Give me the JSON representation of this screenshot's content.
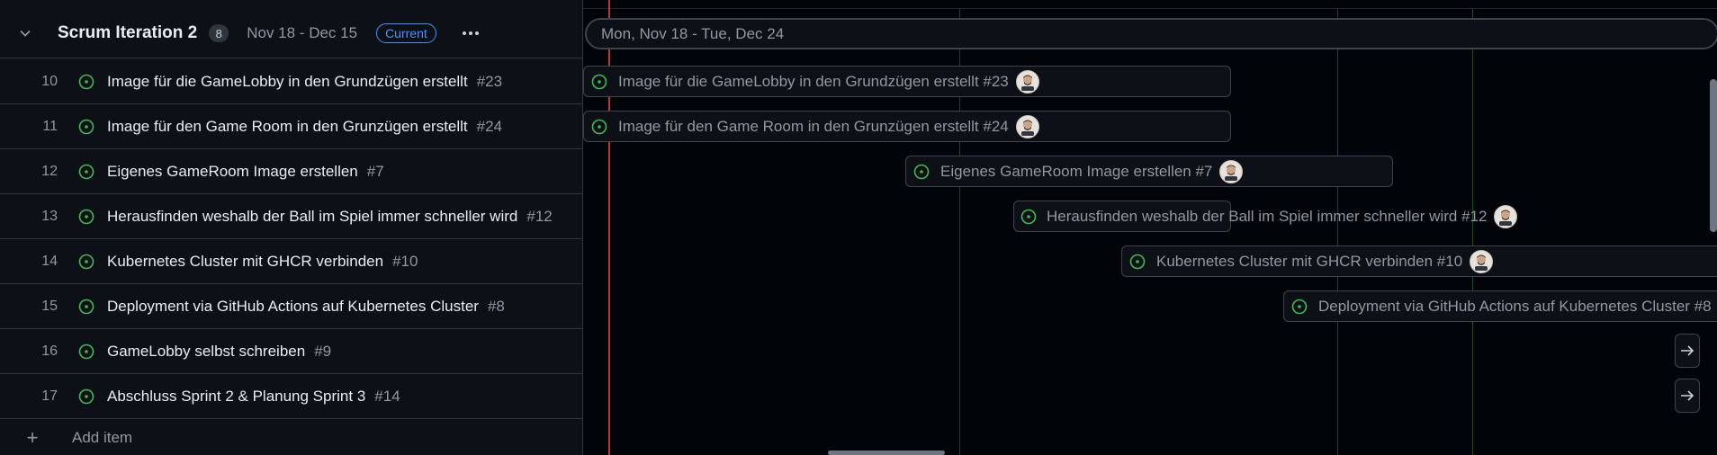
{
  "group": {
    "title": "Scrum Iteration 2",
    "count": "8",
    "date_range": "Nov 18 - Dec 15",
    "badge": "Current"
  },
  "rows": [
    {
      "num": "10",
      "title": "Image für die GameLobby in den Grundzügen erstellt",
      "ref": "#23"
    },
    {
      "num": "11",
      "title": "Image für den Game Room in den Grunzügen erstellt",
      "ref": "#24"
    },
    {
      "num": "12",
      "title": "Eigenes GameRoom Image erstellen",
      "ref": "#7"
    },
    {
      "num": "13",
      "title": "Herausfinden weshalb der Ball im Spiel immer schneller wird",
      "ref": "#12"
    },
    {
      "num": "14",
      "title": "Kubernetes Cluster mit GHCR verbinden",
      "ref": "#10"
    },
    {
      "num": "15",
      "title": "Deployment via GitHub Actions auf Kubernetes Cluster",
      "ref": "#8"
    },
    {
      "num": "16",
      "title": "GameLobby selbst schreiben",
      "ref": "#9"
    },
    {
      "num": "17",
      "title": "Abschluss Sprint 2 & Planung Sprint 3",
      "ref": "#14"
    }
  ],
  "add_item_label": "Add item",
  "timeline": {
    "range_label": "Mon, Nov 18 - Tue, Dec 24",
    "bars": [
      {
        "text": "Image für die GameLobby in den Grundzügen erstellt #23"
      },
      {
        "text": "Image für den Game Room in den Grunzügen erstellt #24"
      },
      {
        "text": "Eigenes GameRoom Image erstellen #7"
      },
      {
        "text": "Herausfinden weshalb der Ball im Spiel immer schneller wird #12"
      },
      {
        "text": "Kubernetes Cluster mit GHCR verbinden #10"
      },
      {
        "text": "Deployment via GitHub Actions auf Kubernetes Cluster #8"
      }
    ]
  },
  "colors": {
    "status_open": "#3fb950",
    "accent": "#4493f8",
    "today_marker": "#b53a3a",
    "background": "#0d1117"
  },
  "icons": {
    "collapse": "chevron-down-icon",
    "status": "issue-open-icon",
    "more": "kebab-icon",
    "add": "plus-icon",
    "navigate": "arrow-right-icon"
  }
}
